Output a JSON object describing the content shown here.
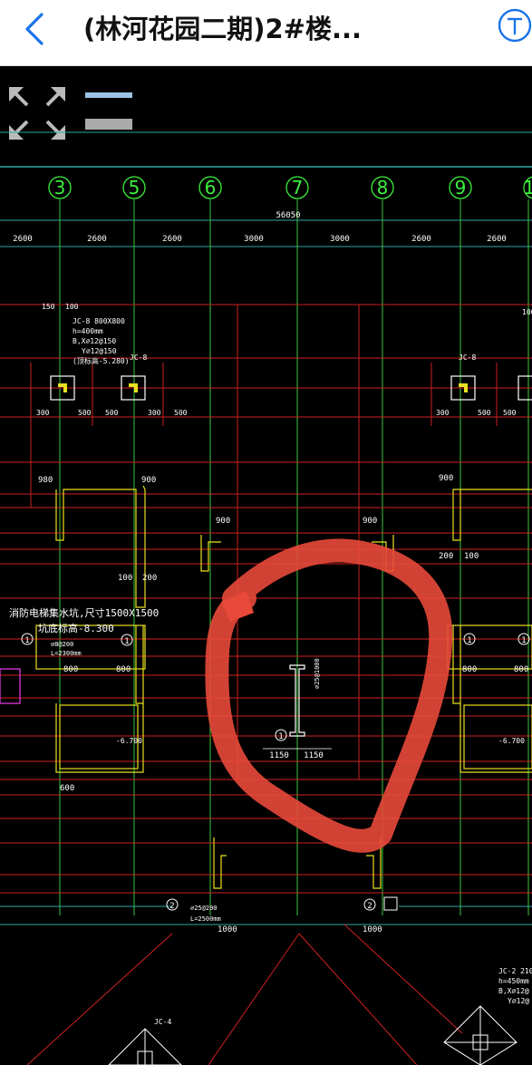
{
  "header": {
    "title": "(林河花园二期)2#楼...",
    "back_icon": "chevron-left-icon",
    "tool_icon": "text-tool-icon",
    "accent": "#1a73e8"
  },
  "toolbar": {
    "fullscreen_icon": "expand-arrows-icon",
    "layer_icon": "layers-icon"
  },
  "drawing": {
    "axes": [
      "3",
      "5",
      "6",
      "7",
      "8",
      "9",
      "1"
    ],
    "total_dim": "56050",
    "spans": [
      "2600",
      "2600",
      "2600",
      "3000",
      "3000",
      "2600",
      "2600"
    ],
    "labels": {
      "jc8_left_spec1": "JC-8 800X800",
      "jc8_left_spec2": "h=400mm",
      "jc8_left_spec3": "B,X⌀12@150",
      "jc8_left_spec4": "Y⌀12@150",
      "jc8_left_spec5": "(顶标高-5.280)",
      "jc8_mid": "JC-8",
      "jc8_right": "JC-8",
      "pit_note": "消防电梯集水坑,尺寸1500X1500",
      "pit_level": "坑底标高-8.300",
      "pit_rebar1": "⌀8@200",
      "pit_rebar2": "L=2300mm",
      "level_left": "-6.700",
      "level_right": "-6.700",
      "col_dim": "1150",
      "col_dim2": "1150",
      "col_v": "⌀25@1000",
      "rebar_bot1": "⌀25@200",
      "rebar_bot2": "L=2500mm",
      "jc2_1": "JC-2 2100",
      "jc2_2": "h=450mm",
      "jc2_3": "B,X⌀12@",
      "jc2_4": "Y⌀12@",
      "jc4": "JC-4",
      "d150": "150",
      "d100": "100",
      "d300": "300",
      "d500": "500",
      "d900": "900",
      "d980": "980",
      "d200": "200",
      "d800": "800",
      "d600": "600",
      "d1000": "1000",
      "circ1": "1",
      "circ2": "2"
    }
  },
  "annotation": {
    "color": "#e8493a"
  }
}
